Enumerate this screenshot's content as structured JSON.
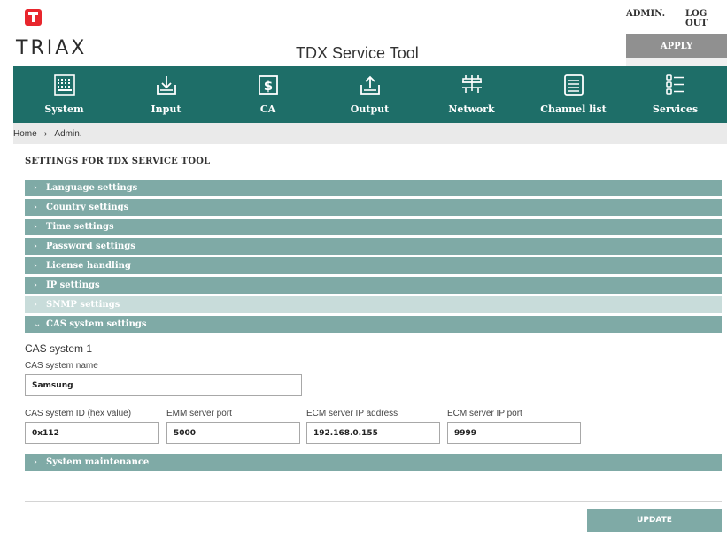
{
  "header": {
    "brand": "TRIAX",
    "app_title": "TDX Service Tool",
    "admin_link": "ADMIN.",
    "logout_link": "LOG OUT",
    "apply_label": "APPLY",
    "brand_color": "#e8262d"
  },
  "nav": {
    "items": [
      {
        "label": "System",
        "icon": "system-icon"
      },
      {
        "label": "Input",
        "icon": "input-icon"
      },
      {
        "label": "CA",
        "icon": "ca-dollar-icon"
      },
      {
        "label": "Output",
        "icon": "output-icon"
      },
      {
        "label": "Network",
        "icon": "network-icon"
      },
      {
        "label": "Channel list",
        "icon": "channel-list-icon"
      },
      {
        "label": "Services",
        "icon": "services-icon"
      }
    ],
    "bg_color": "#1e6e68"
  },
  "breadcrumb": {
    "home": "Home",
    "separator": "›",
    "current": "Admin."
  },
  "page": {
    "title": "SETTINGS FOR TDX SERVICE TOOL"
  },
  "accordion": {
    "sections": [
      {
        "label": "Language settings",
        "state": "collapsed"
      },
      {
        "label": "Country settings",
        "state": "collapsed"
      },
      {
        "label": "Time settings",
        "state": "collapsed"
      },
      {
        "label": "Password settings",
        "state": "collapsed"
      },
      {
        "label": "License handling",
        "state": "collapsed"
      },
      {
        "label": "IP settings",
        "state": "collapsed"
      },
      {
        "label": "SNMP settings",
        "state": "collapsed-disabled"
      },
      {
        "label": "CAS system settings",
        "state": "expanded"
      },
      {
        "label": "System maintenance",
        "state": "collapsed"
      }
    ],
    "collapsed_chevron": "›",
    "expanded_chevron": "⌄",
    "color": "#7faaa6"
  },
  "cas": {
    "heading": "CAS system 1",
    "name_label": "CAS system name",
    "name_value": "Samsung",
    "id_label": "CAS system ID (hex value)",
    "id_value": "0x112",
    "emm_port_label": "EMM server port",
    "emm_port_value": "5000",
    "ecm_ip_label": "ECM server IP address",
    "ecm_ip_value": "192.168.0.155",
    "ecm_port_label": "ECM server IP port",
    "ecm_port_value": "9999"
  },
  "footer": {
    "update_label": "UPDATE"
  }
}
